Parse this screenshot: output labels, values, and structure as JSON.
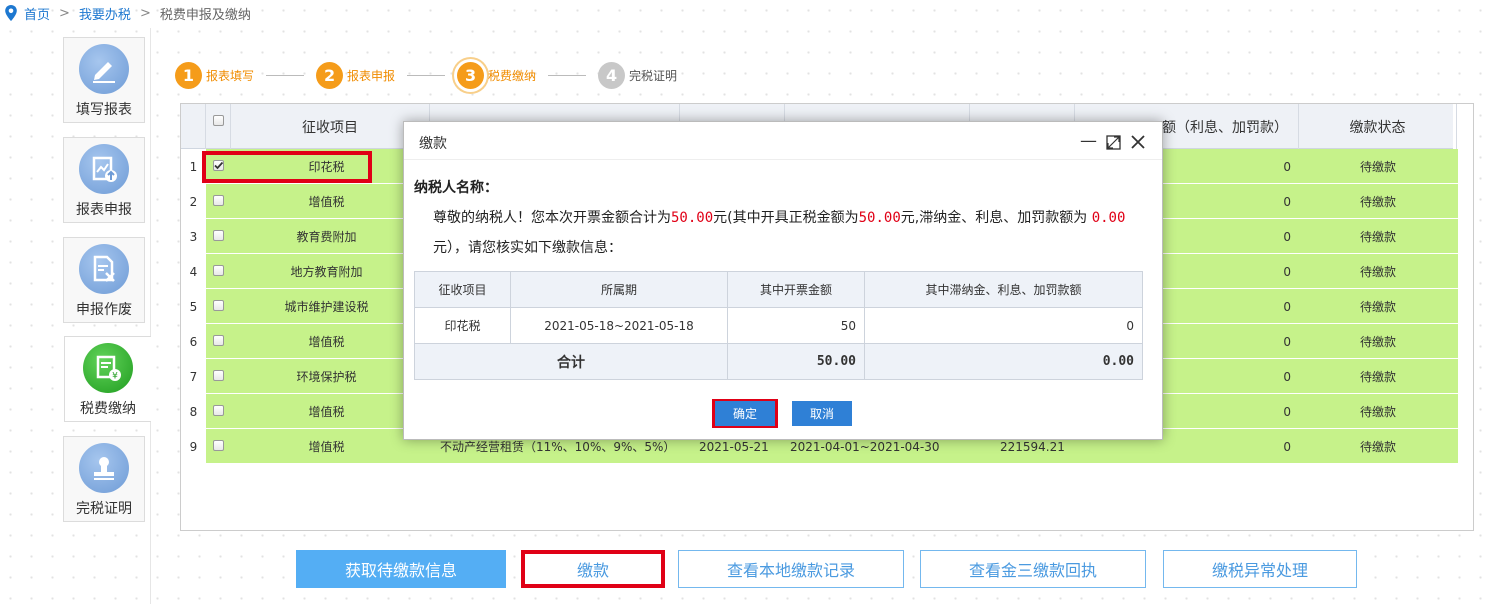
{
  "breadcrumb": {
    "home": "首页",
    "sep1": ">",
    "tax": "我要办税",
    "sep2": ">",
    "current": "税费申报及缴纳"
  },
  "sidebar": [
    {
      "label": "填写报表",
      "icon": "pencil-icon"
    },
    {
      "label": "报表申报",
      "icon": "report-upload-icon"
    },
    {
      "label": "申报作废",
      "icon": "report-void-icon"
    },
    {
      "label": "税费缴纳",
      "icon": "tax-payment-icon",
      "active": true
    },
    {
      "label": "完税证明",
      "icon": "stamp-icon"
    }
  ],
  "steps": [
    {
      "num": "1",
      "label": "报表填写",
      "state": "done"
    },
    {
      "num": "2",
      "label": "报表申报",
      "state": "done"
    },
    {
      "num": "3",
      "label": "税费缴纳",
      "state": "current"
    },
    {
      "num": "4",
      "label": "完税证明",
      "state": "todo"
    }
  ],
  "table": {
    "headers": {
      "item": "征收项目",
      "late": "额（利息、加罚款）",
      "status": "缴款状态"
    },
    "rows": [
      {
        "no": "1",
        "item": "印花税",
        "amount": "0",
        "status": "待缴款",
        "checked": true
      },
      {
        "no": "2",
        "item": "增值税",
        "amount": "0",
        "status": "待缴款"
      },
      {
        "no": "3",
        "item": "教育费附加",
        "amount": "0",
        "status": "待缴款"
      },
      {
        "no": "4",
        "item": "地方教育附加",
        "amount": "0",
        "status": "待缴款"
      },
      {
        "no": "5",
        "item": "城市维护建设税",
        "amount": "0",
        "status": "待缴款"
      },
      {
        "no": "6",
        "item": "增值税",
        "amount": "0",
        "status": "待缴款"
      },
      {
        "no": "7",
        "item": "环境保护税",
        "amount": "0",
        "status": "待缴款"
      },
      {
        "no": "8",
        "item": "增值税",
        "amount": "0",
        "status": "待缴款"
      },
      {
        "no": "9",
        "item": "增值税",
        "detail": "不动产经营租赁（11%、10%、9%、5%）",
        "date": "2021-05-21",
        "period": "2021-04-01~2021-04-30",
        "tax": "221594.21",
        "amount": "0",
        "status": "待缴款"
      }
    ]
  },
  "buttons": {
    "fetch": "获取待缴款信息",
    "pay": "缴款",
    "local_records": "查看本地缴款记录",
    "receipt": "查看金三缴款回执",
    "exception": "缴税异常处理"
  },
  "modal": {
    "title": "缴款",
    "payer_label": "纳税人名称：",
    "line1_a": "尊敬的纳税人！您本次开票金额合计为",
    "amount1": "50.00",
    "line1_b": "元(其中开具正税金额为",
    "amount2": "50.00",
    "line1_c": "元,滞纳金、利息、加罚款额为",
    "amount3": "0.00",
    "line2": "元），请您核实如下缴款信息：",
    "table": {
      "headers": [
        "征收项目",
        "所属期",
        "其中开票金额",
        "其中滞纳金、利息、加罚款额"
      ],
      "row": {
        "item": "印花税",
        "period": "2021-05-18~2021-05-18",
        "amount": "50",
        "late": "0"
      },
      "total": {
        "label": "合计",
        "amount": "50.00",
        "late": "0.00"
      }
    },
    "ok": "确定",
    "cancel": "取消"
  }
}
